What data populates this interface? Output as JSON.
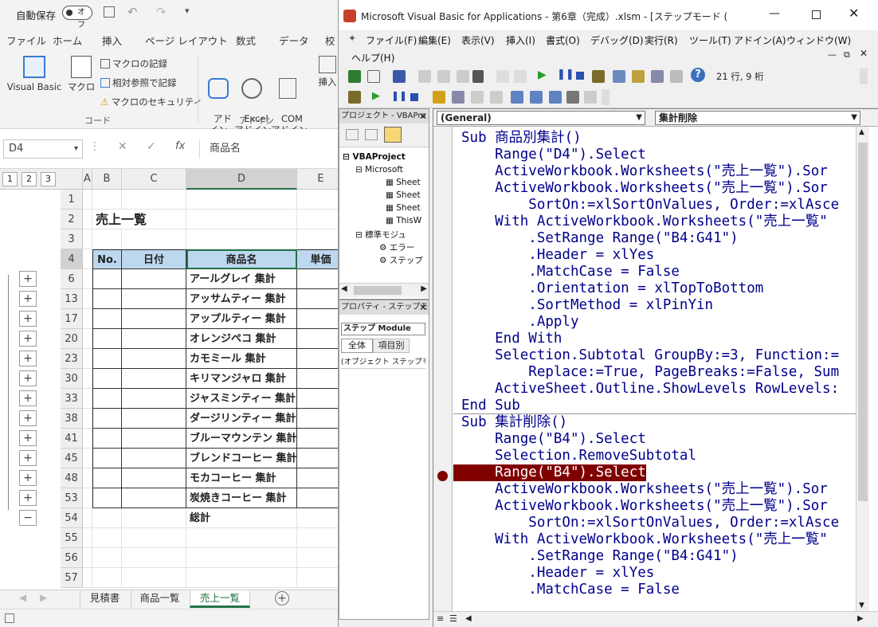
{
  "excel": {
    "autosave_label": "自動保存",
    "autosave_state": "オフ",
    "tabs": [
      "ファイル",
      "ホーム",
      "挿入",
      "ページ レイアウト",
      "数式",
      "データ",
      "校"
    ],
    "ribbon": {
      "vb": "Visual Basic",
      "macro": "マクロ",
      "record": "マクロの記録",
      "relative": "相対参照で記録",
      "security": "マクロのセキュリティ",
      "group_code": "コード",
      "addin": "アド\nイン",
      "excel_addin": "Excel\nアドイン",
      "com_addin": "COM\nアドイン",
      "group_addin": "アドイン",
      "insert": "挿入"
    },
    "namebox": "D4",
    "formula": "商品名",
    "levels": [
      "1",
      "2",
      "3"
    ],
    "columns": [
      "A",
      "B",
      "C",
      "D",
      "E"
    ],
    "rows": [
      {
        "n": "1",
        "d": ""
      },
      {
        "n": "2",
        "d": ""
      },
      {
        "n": "3",
        "d": ""
      },
      {
        "n": "4",
        "d": ""
      },
      {
        "n": "6",
        "d": "アールグレイ 集計",
        "p": "+"
      },
      {
        "n": "13",
        "d": "アッサムティー 集計",
        "p": "+"
      },
      {
        "n": "17",
        "d": "アップルティー 集計",
        "p": "+"
      },
      {
        "n": "20",
        "d": "オレンジペコ 集計",
        "p": "+"
      },
      {
        "n": "23",
        "d": "カモミール 集計",
        "p": "+"
      },
      {
        "n": "30",
        "d": "キリマンジャロ 集計",
        "p": "+"
      },
      {
        "n": "33",
        "d": "ジャスミンティー 集計",
        "p": "+"
      },
      {
        "n": "38",
        "d": "ダージリンティー 集計",
        "p": "+"
      },
      {
        "n": "41",
        "d": "ブルーマウンテン 集計",
        "p": "+"
      },
      {
        "n": "45",
        "d": "ブレンドコーヒー 集計",
        "p": "+"
      },
      {
        "n": "48",
        "d": "モカコーヒー 集計",
        "p": "+"
      },
      {
        "n": "53",
        "d": "炭焼きコーヒー 集計",
        "p": "+"
      },
      {
        "n": "54",
        "d": "総計",
        "p": "−"
      },
      {
        "n": "55",
        "d": ""
      },
      {
        "n": "56",
        "d": ""
      },
      {
        "n": "57",
        "d": ""
      }
    ],
    "sheet_title": "売上一覧",
    "headers": {
      "no": "No.",
      "date": "日付",
      "name": "商品名",
      "price": "単価"
    },
    "sheets": [
      "見積書",
      "商品一覧",
      "売上一覧"
    ]
  },
  "vbe": {
    "title": "Microsoft Visual Basic for Applications - 第6章（完成）.xlsm - [ステップモード (コード)]",
    "menus": [
      "ファイル(F)",
      "編集(E)",
      "表示(V)",
      "挿入(I)",
      "書式(O)",
      "デバッグ(D)",
      "実行(R)",
      "ツール(T)",
      "アドイン(A)",
      "ウィンドウ(W)",
      "ヘルプ(H)"
    ],
    "position": "21 行, 9 桁",
    "project_title": "プロジェクト - VBAPro",
    "tree": [
      "VBAProject",
      "Microsoft",
      "Sheet",
      "Sheet",
      "Sheet",
      "ThisW",
      "標準モジュ",
      "エラー",
      "ステップ"
    ],
    "props_title": "プロパティ - ステップモ",
    "props_combo": "ステップ Module",
    "props_tabs": [
      "全体",
      "項目別"
    ],
    "props_row": "(オブジェクト ステップモ",
    "combo_left": "(General)",
    "combo_right": "集計削除",
    "code": [
      "Sub 商品別集計()",
      "    Range(\"D4\").Select",
      "    ActiveWorkbook.Worksheets(\"売上一覧\").Sor",
      "    ActiveWorkbook.Worksheets(\"売上一覧\").Sor",
      "        SortOn:=xlSortOnValues, Order:=xlAsce",
      "    With ActiveWorkbook.Worksheets(\"売上一覧\"",
      "        .SetRange Range(\"B4:G41\")",
      "        .Header = xlYes",
      "        .MatchCase = False",
      "        .Orientation = xlTopToBottom",
      "        .SortMethod = xlPinYin",
      "        .Apply",
      "    End With",
      "    Selection.Subtotal GroupBy:=3, Function:=",
      "        Replace:=True, PageBreaks:=False, Sum",
      "    ActiveSheet.Outline.ShowLevels RowLevels:",
      "End Sub",
      "Sub 集計削除()",
      "    Range(\"B4\").Select",
      "    Selection.RemoveSubtotal",
      "    Range(\"B4\").Select",
      "    ActiveWorkbook.Worksheets(\"売上一覧\").Sor",
      "    ActiveWorkbook.Worksheets(\"売上一覧\").Sor",
      "        SortOn:=xlSortOnValues, Order:=xlAsce",
      "    With ActiveWorkbook.Worksheets(\"売上一覧\"",
      "        .SetRange Range(\"B4:G41\")",
      "        .Header = xlYes",
      "        .MatchCase = False"
    ],
    "breakpoint_line": 20,
    "separator_after": 16
  }
}
